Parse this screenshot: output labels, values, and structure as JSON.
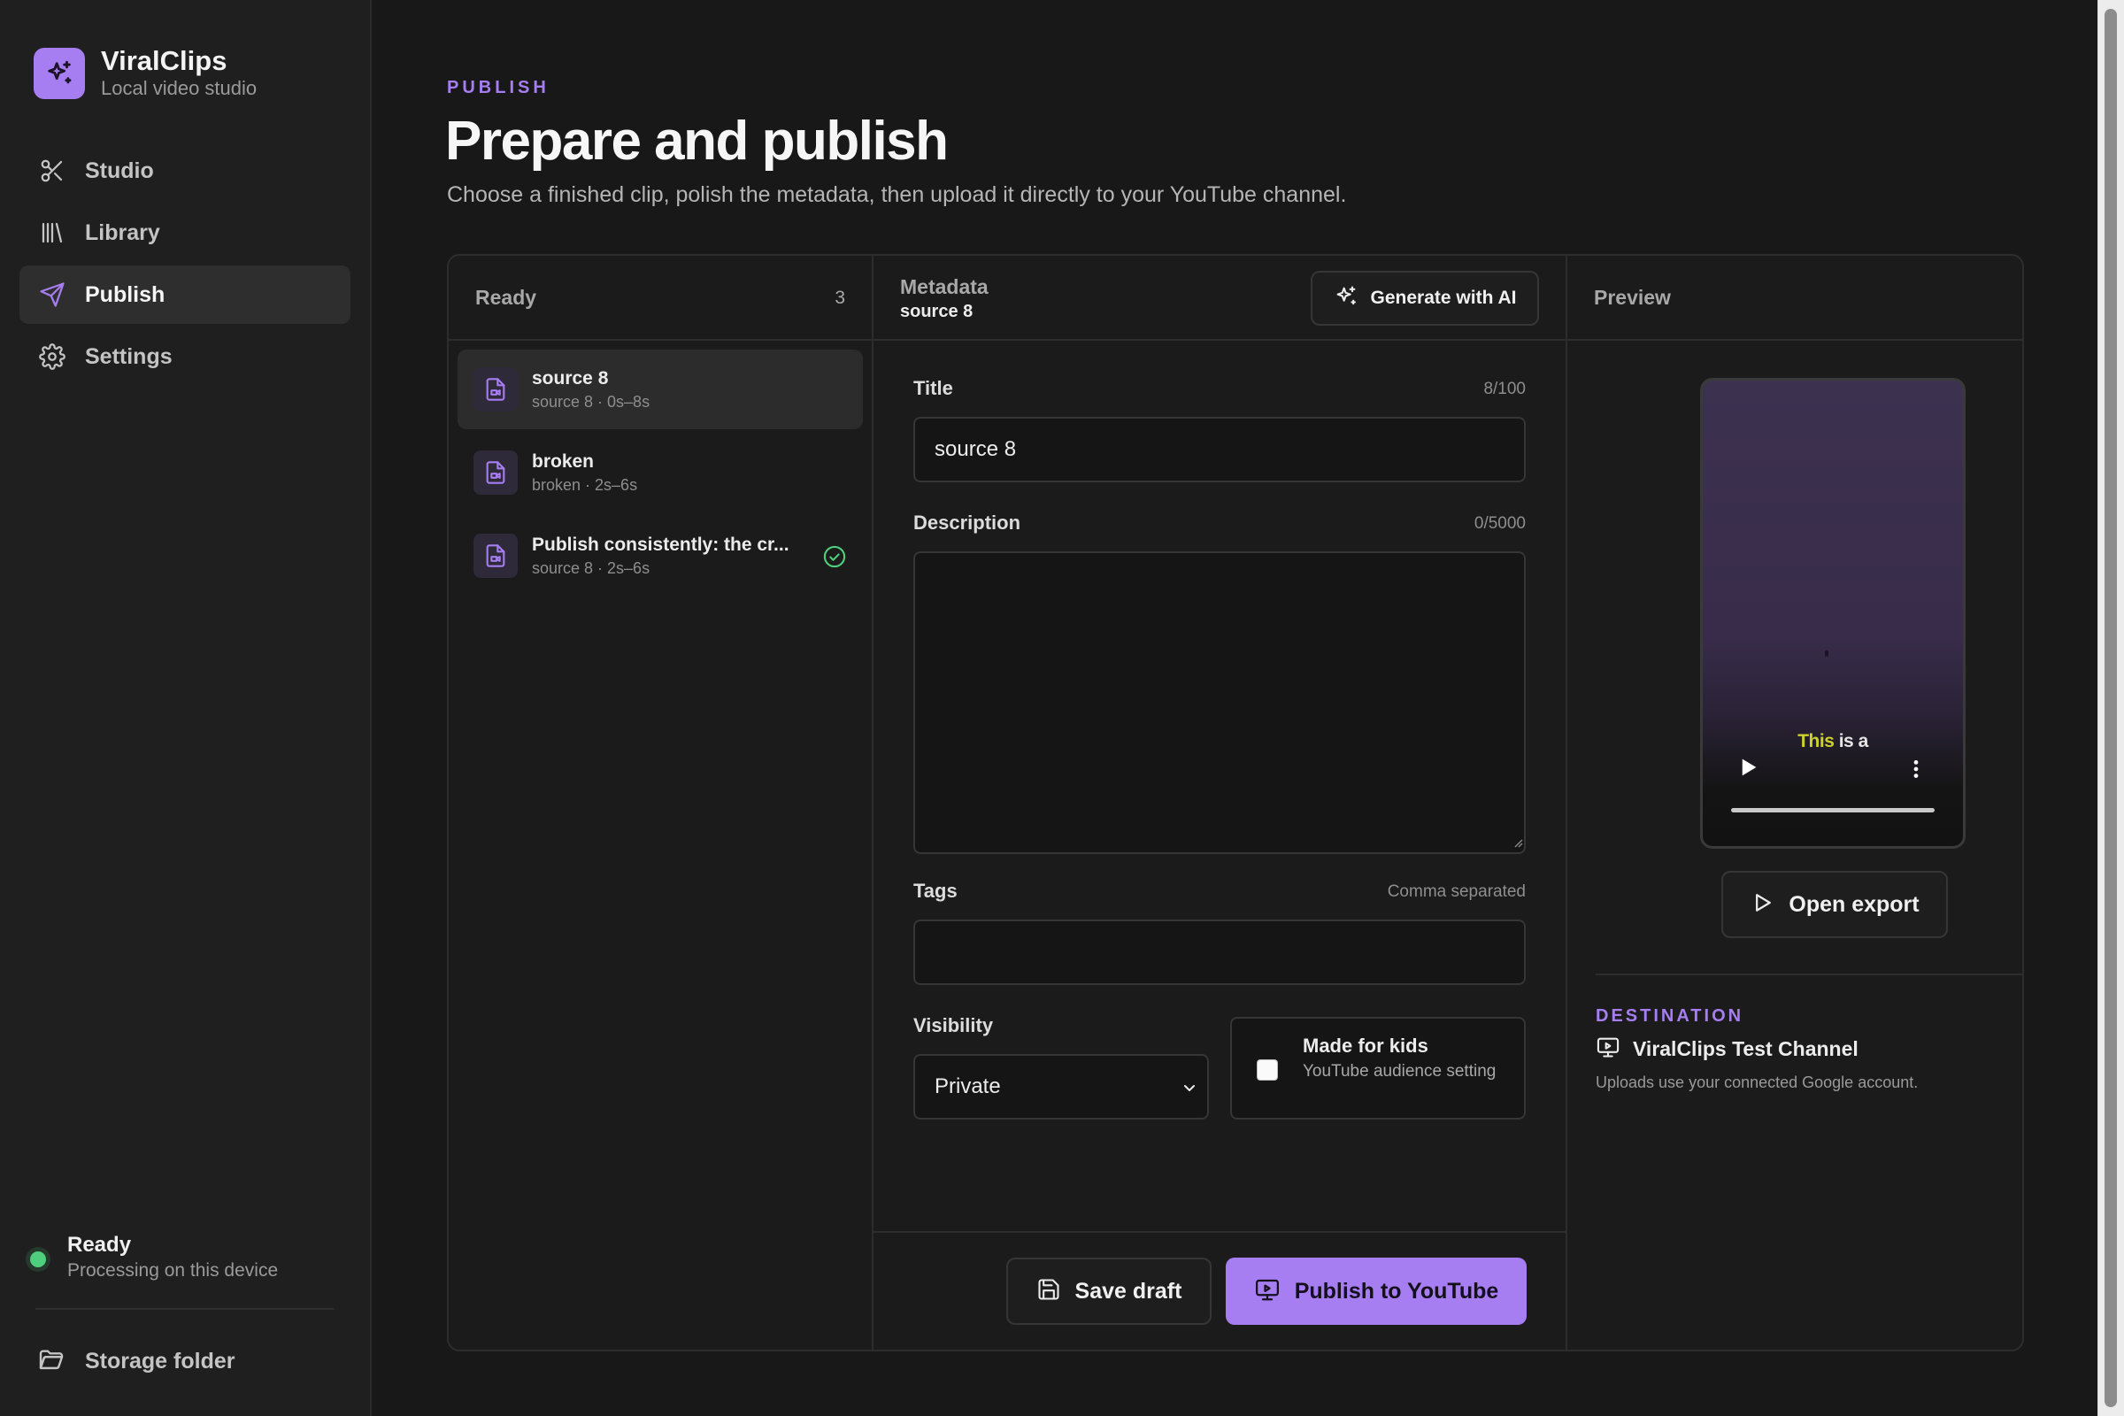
{
  "app": {
    "name": "ViralClips",
    "tagline": "Local video studio"
  },
  "sidebar": {
    "items": [
      {
        "label": "Studio",
        "icon": "scissors-icon",
        "active": false
      },
      {
        "label": "Library",
        "icon": "library-icon",
        "active": false
      },
      {
        "label": "Publish",
        "icon": "send-icon",
        "active": true
      },
      {
        "label": "Settings",
        "icon": "gear-icon",
        "active": false
      }
    ],
    "status": {
      "title": "Ready",
      "subtitle": "Processing on this device",
      "color": "#4fcf7d"
    },
    "storage_label": "Storage folder"
  },
  "header": {
    "eyebrow": "PUBLISH",
    "title": "Prepare and publish",
    "subtitle": "Choose a finished clip, polish the metadata, then upload it directly to your YouTube channel."
  },
  "ready": {
    "label": "Ready",
    "count": "3",
    "clips": [
      {
        "name": "source 8",
        "meta": "source 8 · 0s–8s",
        "selected": true,
        "published": false
      },
      {
        "name": "broken",
        "meta": "broken · 2s–6s",
        "selected": false,
        "published": false
      },
      {
        "name": "Publish consistently: the creator's playbook",
        "name_shown": "Publish consistently: the cr...",
        "meta": "source 8 · 2s–6s",
        "selected": false,
        "published": true
      }
    ]
  },
  "metadata": {
    "label": "Metadata",
    "clip_name": "source 8",
    "generate_label": "Generate with AI",
    "title_label": "Title",
    "title_count": "8/100",
    "title_value": "source 8",
    "description_label": "Description",
    "description_count": "0/5000",
    "description_value": "",
    "tags_label": "Tags",
    "tags_hint": "Comma separated",
    "tags_value": "",
    "visibility_label": "Visibility",
    "visibility_value": "Private",
    "kids_title": "Made for kids",
    "kids_subtitle": "YouTube audience setting",
    "kids_checked": false,
    "save_label": "Save draft",
    "publish_label": "Publish to YouTube"
  },
  "preview": {
    "label": "Preview",
    "caption_highlight": "This",
    "caption_rest": " is a",
    "open_label": "Open export",
    "destination_eyebrow": "DESTINATION",
    "channel": "ViralClips Test Channel",
    "note": "Uploads use your connected Google account."
  },
  "colors": {
    "accent": "#a77ef2",
    "background": "#181818",
    "sidebar": "#1f1f1f",
    "status_ok": "#4fcf7d",
    "caption_highlight": "#cdd12c"
  }
}
